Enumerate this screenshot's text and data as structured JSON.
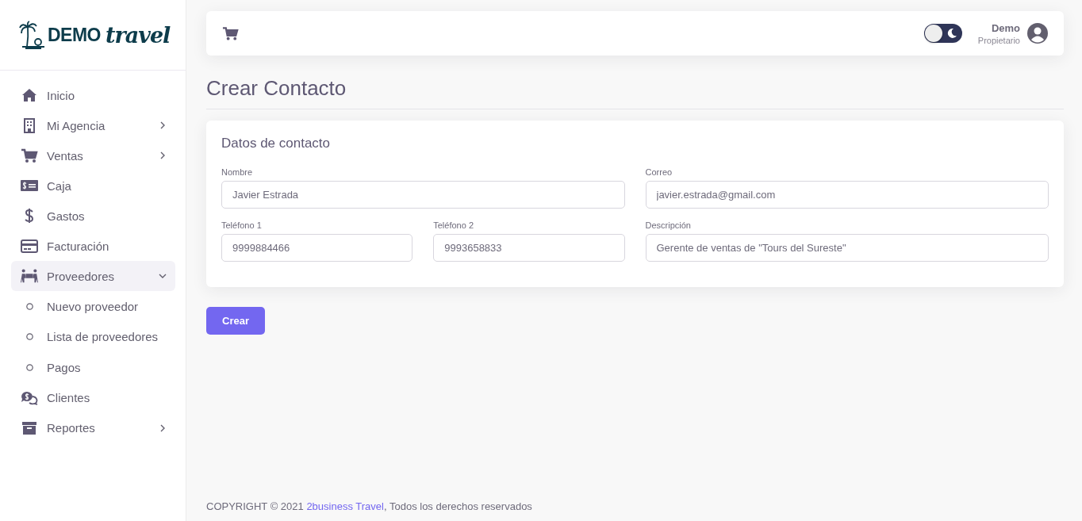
{
  "logo": {
    "word": "DEMO",
    "script": "travel"
  },
  "sidebar": {
    "items": [
      {
        "label": "Inicio",
        "selected": false
      },
      {
        "label": "Mi Agencia",
        "selected": false,
        "expanded": false
      },
      {
        "label": "Ventas",
        "selected": false,
        "expanded": false
      },
      {
        "label": "Caja",
        "selected": false
      },
      {
        "label": "Gastos",
        "selected": false
      },
      {
        "label": "Facturación",
        "selected": false
      },
      {
        "label": "Proveedores",
        "selected": true,
        "expanded": true,
        "children": [
          {
            "label": "Nuevo proveedor",
            "selected": false
          },
          {
            "label": "Lista de proveedores",
            "selected": false
          },
          {
            "label": "Pagos",
            "selected": false
          }
        ]
      },
      {
        "label": "Clientes",
        "selected": false
      },
      {
        "label": "Reportes",
        "selected": false,
        "expanded": false
      }
    ]
  },
  "topbar": {
    "dark_mode": false,
    "user": {
      "name": "Demo",
      "role": "Propietario"
    }
  },
  "page_title": "Crear Contacto",
  "card": {
    "title": "Datos de contacto",
    "fields": [
      {
        "label": "Nombre",
        "value": "Javier Estrada"
      },
      {
        "label": "Correo",
        "value": "javier.estrada@gmail.com"
      },
      {
        "label": "Teléfono 1",
        "value": "9999884466"
      },
      {
        "label": "Teléfono 2",
        "value": "9993658833"
      },
      {
        "label": "Descripción",
        "value": "Gerente de ventas de \"Tours del Sureste\""
      }
    ]
  },
  "submit_button": "Crear",
  "footer": {
    "prefix": "COPYRIGHT © 2021 ",
    "link": "2business Travel",
    "suffix": ", Todos los derechos reservados"
  }
}
